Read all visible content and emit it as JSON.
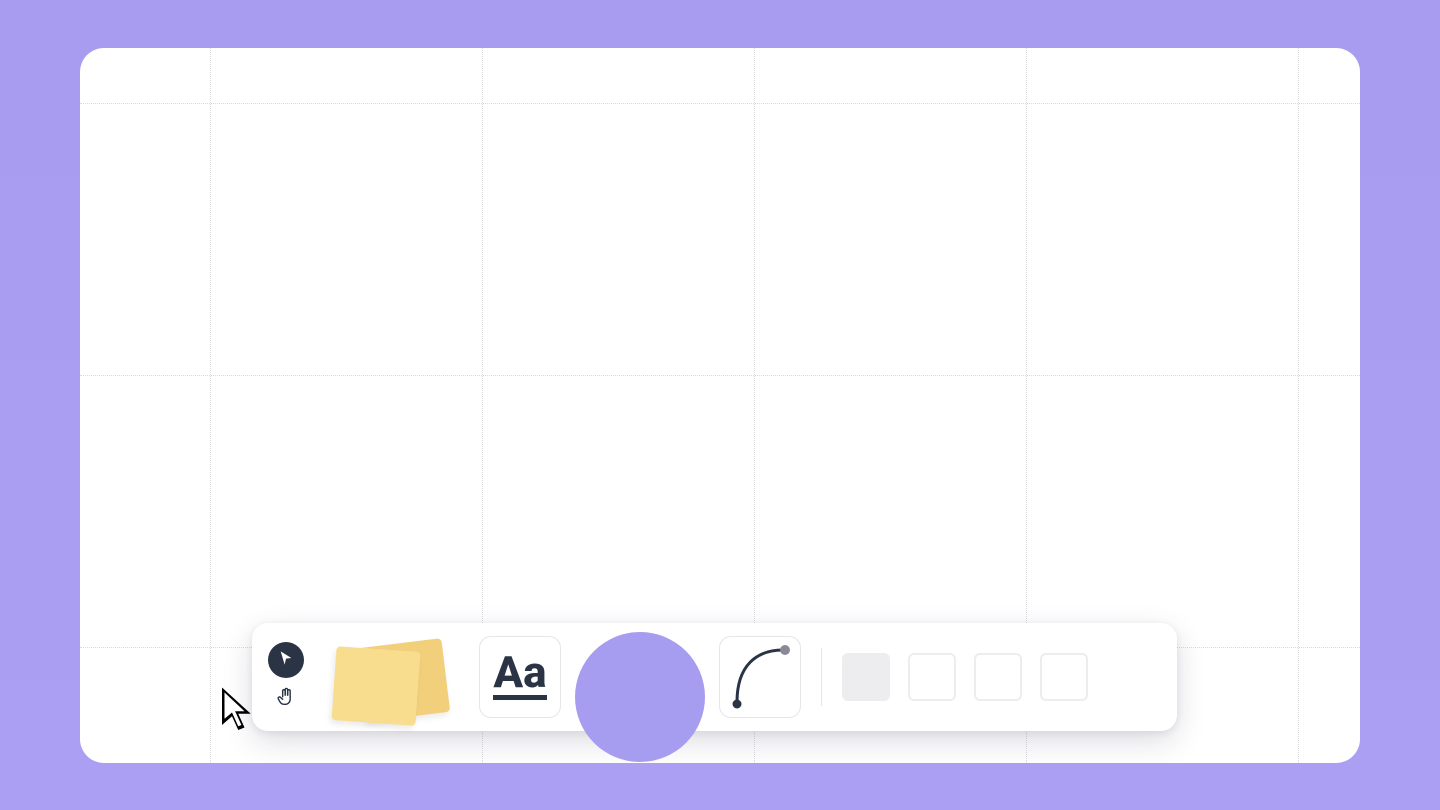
{
  "canvas": {
    "grid": {
      "cols": 5,
      "rows": 3
    }
  },
  "toolbar": {
    "cursor": {
      "name": "select"
    },
    "hand": {
      "name": "hand"
    },
    "sticky": {
      "name": "sticky-note"
    },
    "text": {
      "label": "Aa"
    },
    "shape": {
      "name": "ellipse",
      "color": "#A79DF0"
    },
    "connector": {
      "name": "connector"
    },
    "swatches": [
      {
        "type": "filled"
      },
      {
        "type": "outlined"
      },
      {
        "type": "outlined"
      },
      {
        "type": "outlined"
      }
    ]
  }
}
